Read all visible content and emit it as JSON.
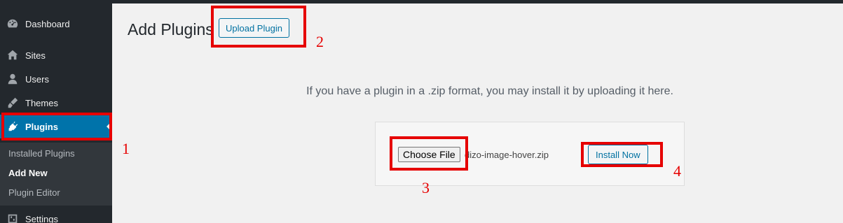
{
  "sidebar": {
    "items": [
      {
        "label": "Dashboard",
        "icon": "dashboard-icon"
      },
      {
        "label": "Sites",
        "icon": "sites-icon"
      },
      {
        "label": "Users",
        "icon": "users-icon"
      },
      {
        "label": "Themes",
        "icon": "themes-icon"
      },
      {
        "label": "Plugins",
        "icon": "plugins-icon"
      },
      {
        "label": "Settings",
        "icon": "settings-icon"
      }
    ],
    "submenu": [
      "Installed Plugins",
      "Add New",
      "Plugin Editor"
    ]
  },
  "page": {
    "title": "Add Plugins",
    "upload_button": "Upload Plugin",
    "help_text": "If you have a plugin in a .zip format, you may install it by uploading it here.",
    "choose_file": "Choose File",
    "file_name": "dizo-image-hover.zip",
    "install_button": "Install Now"
  },
  "annotations": {
    "color": "#e60000",
    "labels": [
      "1",
      "2",
      "3",
      "4"
    ]
  },
  "colors": {
    "sidebar_bg": "#23282d",
    "active_bg": "#0073aa",
    "link_blue": "#0071a1"
  }
}
